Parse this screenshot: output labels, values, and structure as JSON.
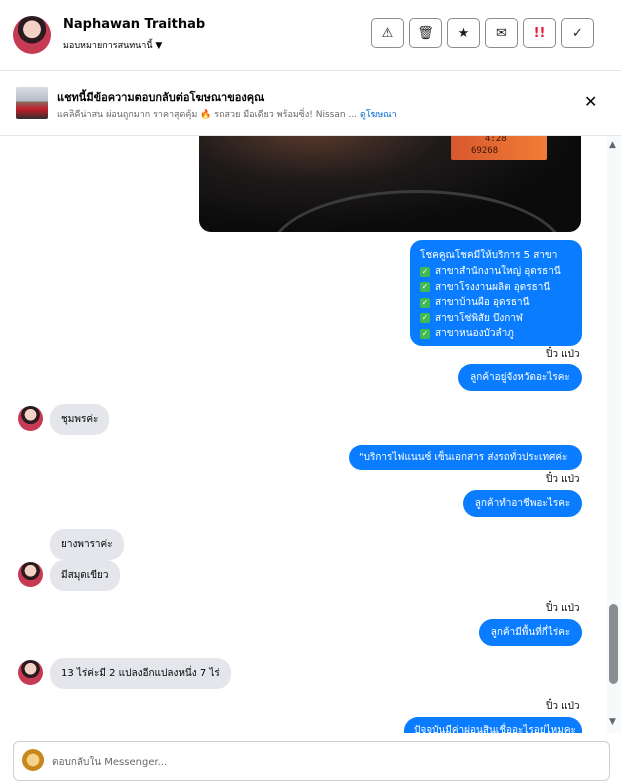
{
  "header": {
    "name": "Naphawan Traithab",
    "assign_label": "มอบหมายการสนทนานี้",
    "actions": [
      {
        "icon": "warning-icon",
        "glyph": "⚠"
      },
      {
        "icon": "trash-icon",
        "glyph": "🗑"
      },
      {
        "icon": "star-icon",
        "glyph": "★"
      },
      {
        "icon": "mail-icon",
        "glyph": "✉"
      },
      {
        "icon": "spam-icon",
        "glyph": "!!"
      },
      {
        "icon": "check-icon",
        "glyph": "✓"
      }
    ]
  },
  "ad_banner": {
    "title": "แชทนี้มีข้อความตอบกลับต่อโฆษณาของคุณ",
    "text": "แคลิคีน่าสน ผ่อนถูกมาก ราคาสุดคุ้ม 🔥 รถสวย มือเดียว พร้อมซิ่ง! Nissan ...",
    "link": "ดูโฆษณา",
    "close_icon": "close-icon"
  },
  "photo": {
    "odometer_time": "4:28",
    "odometer_km": "69268"
  },
  "messages": {
    "branches": {
      "title": "โชคคูณโชคมีให้บริการ 5 สาขา",
      "items": [
        "สาขาสำนักงานใหญ่ อุดรธานี",
        "สาขาโรงงานผลิต อุดรธานี",
        "สาขาบ้านผือ อุดรธานี",
        "สาขาโซ่พิสัย บึงกาฬ",
        "สาขาหนองบัวลำภู"
      ]
    },
    "seen_1": "ปิ๋ว แป่ว",
    "out_province": "ลูกค้าอยู่จังหวัดอะไรคะ",
    "in_chumphon": "ชุมพรค่ะ",
    "out_service": "\"บริการไฟแนนซ์ เซ็นเอกสาร ส่งรถทั่วประเทศค่ะ",
    "seen_2": "ปิ๋ว แป่ว",
    "out_job": "ลูกค้าทำอาชีพอะไรคะ",
    "in_rubber": "ยางพาราค่ะ",
    "in_durian": "มีสมุดเขียว",
    "seen_3": "ปิ๋ว แป่ว",
    "out_land": "ลูกค้ามีพื้นที่กี่ไร่คะ",
    "in_land": "13 ไร่ค่ะมี 2 แปลงอีกแปลงหนึ่ง 7 ไร่",
    "seen_4": "ปิ๋ว แป่ว",
    "out_partial": "ปัจจุบันมีค่าผ่อนสินเชื่ออะไรอยู่ไหมคะ"
  },
  "composer": {
    "placeholder": "ตอบกลับใน Messenger..."
  }
}
